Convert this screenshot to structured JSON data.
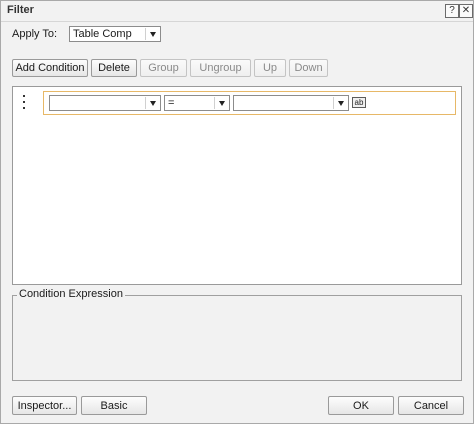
{
  "dialog": {
    "title": "Filter",
    "help_glyph": "?",
    "close_glyph": "✕"
  },
  "apply_to": {
    "label": "Apply To:",
    "value": "Table Comp"
  },
  "toolbar": {
    "add_condition": "Add Condition",
    "delete": "Delete",
    "group": "Group",
    "ungroup": "Ungroup",
    "up": "Up",
    "down": "Down"
  },
  "condition_row": {
    "field_value": "",
    "operator_value": "=",
    "operand_value": "",
    "value_type_icon": "ab"
  },
  "expression": {
    "legend": "Condition Expression",
    "text": ""
  },
  "footer": {
    "inspector": "Inspector...",
    "basic": "Basic",
    "ok": "OK",
    "cancel": "Cancel"
  },
  "colors": {
    "row_highlight": "#e7b867",
    "dialog_bg": "#f2f2f2"
  }
}
